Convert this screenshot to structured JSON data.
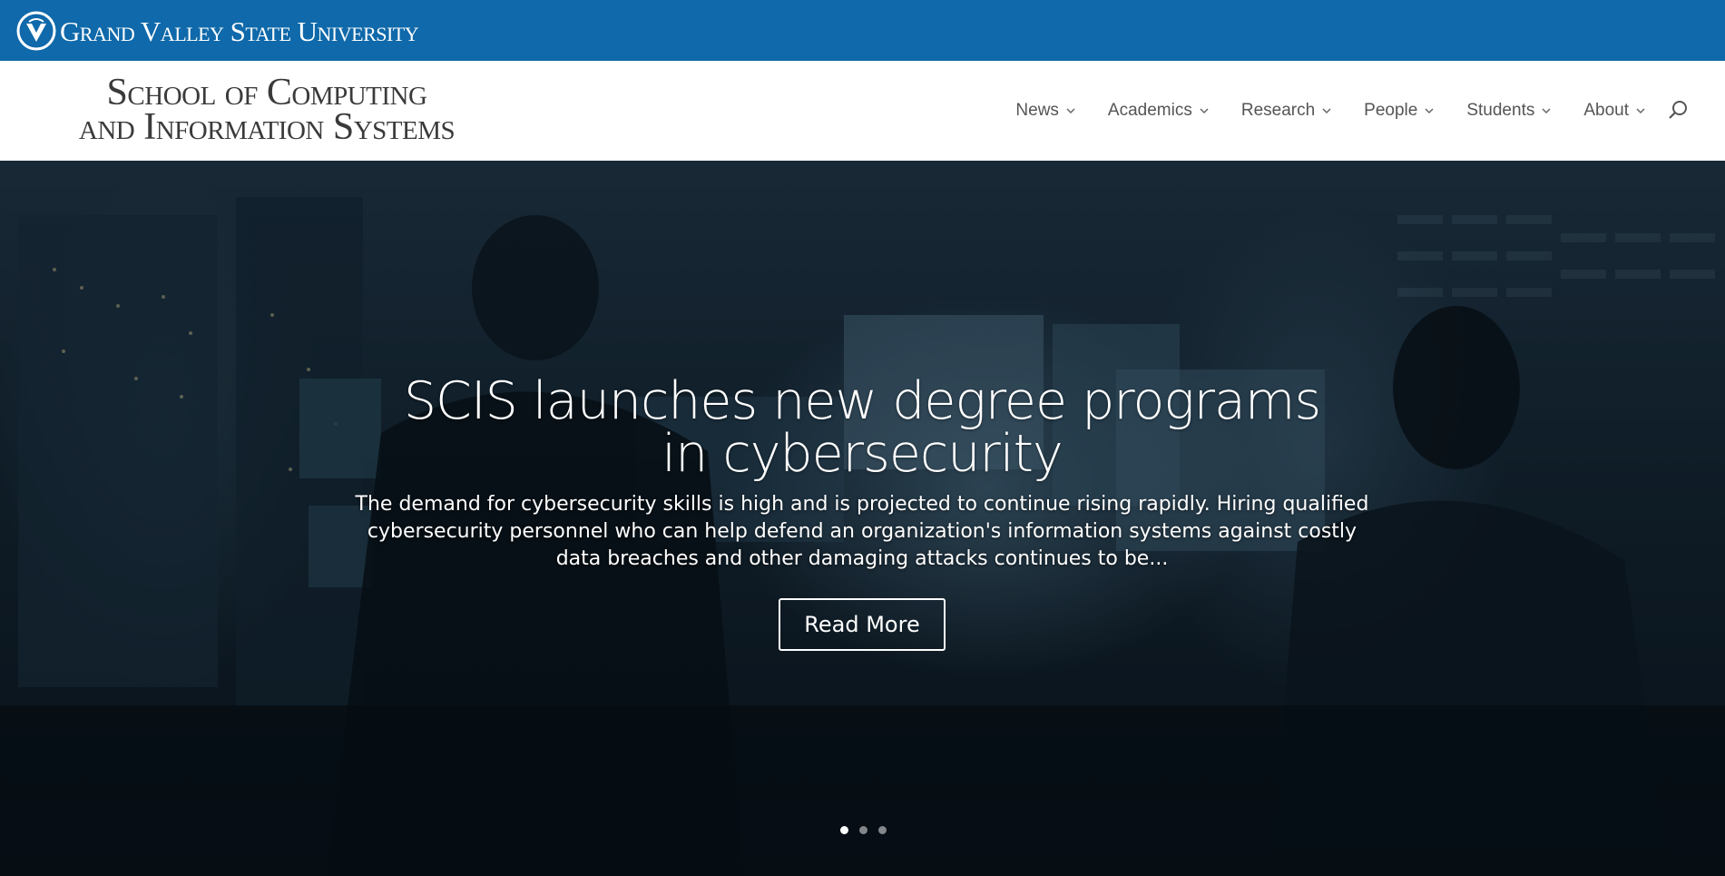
{
  "university": {
    "wordmark": "Grand Valley State University",
    "logo_icon": "gvsu-v-logo"
  },
  "site": {
    "title_line1": "School of Computing",
    "title_line2": "and Information Systems"
  },
  "nav": {
    "items": [
      {
        "label": "News"
      },
      {
        "label": "Academics"
      },
      {
        "label": "Research"
      },
      {
        "label": "People"
      },
      {
        "label": "Students"
      },
      {
        "label": "About"
      }
    ],
    "search_icon": "search-icon"
  },
  "hero": {
    "title": "SCIS launches new degree programs in cybersecurity",
    "text": "The demand for cybersecurity skills is high and is projected to continue rising rapidly. Hiring qualified cybersecurity personnel who can help defend an organization's information systems against costly data breaches and other damaging attacks continues to be...",
    "button_label": "Read More",
    "slides": 3,
    "active_slide": 1
  },
  "colors": {
    "topbar": "#0f69aa",
    "header_bg": "#ffffff",
    "nav_text": "#555555"
  }
}
